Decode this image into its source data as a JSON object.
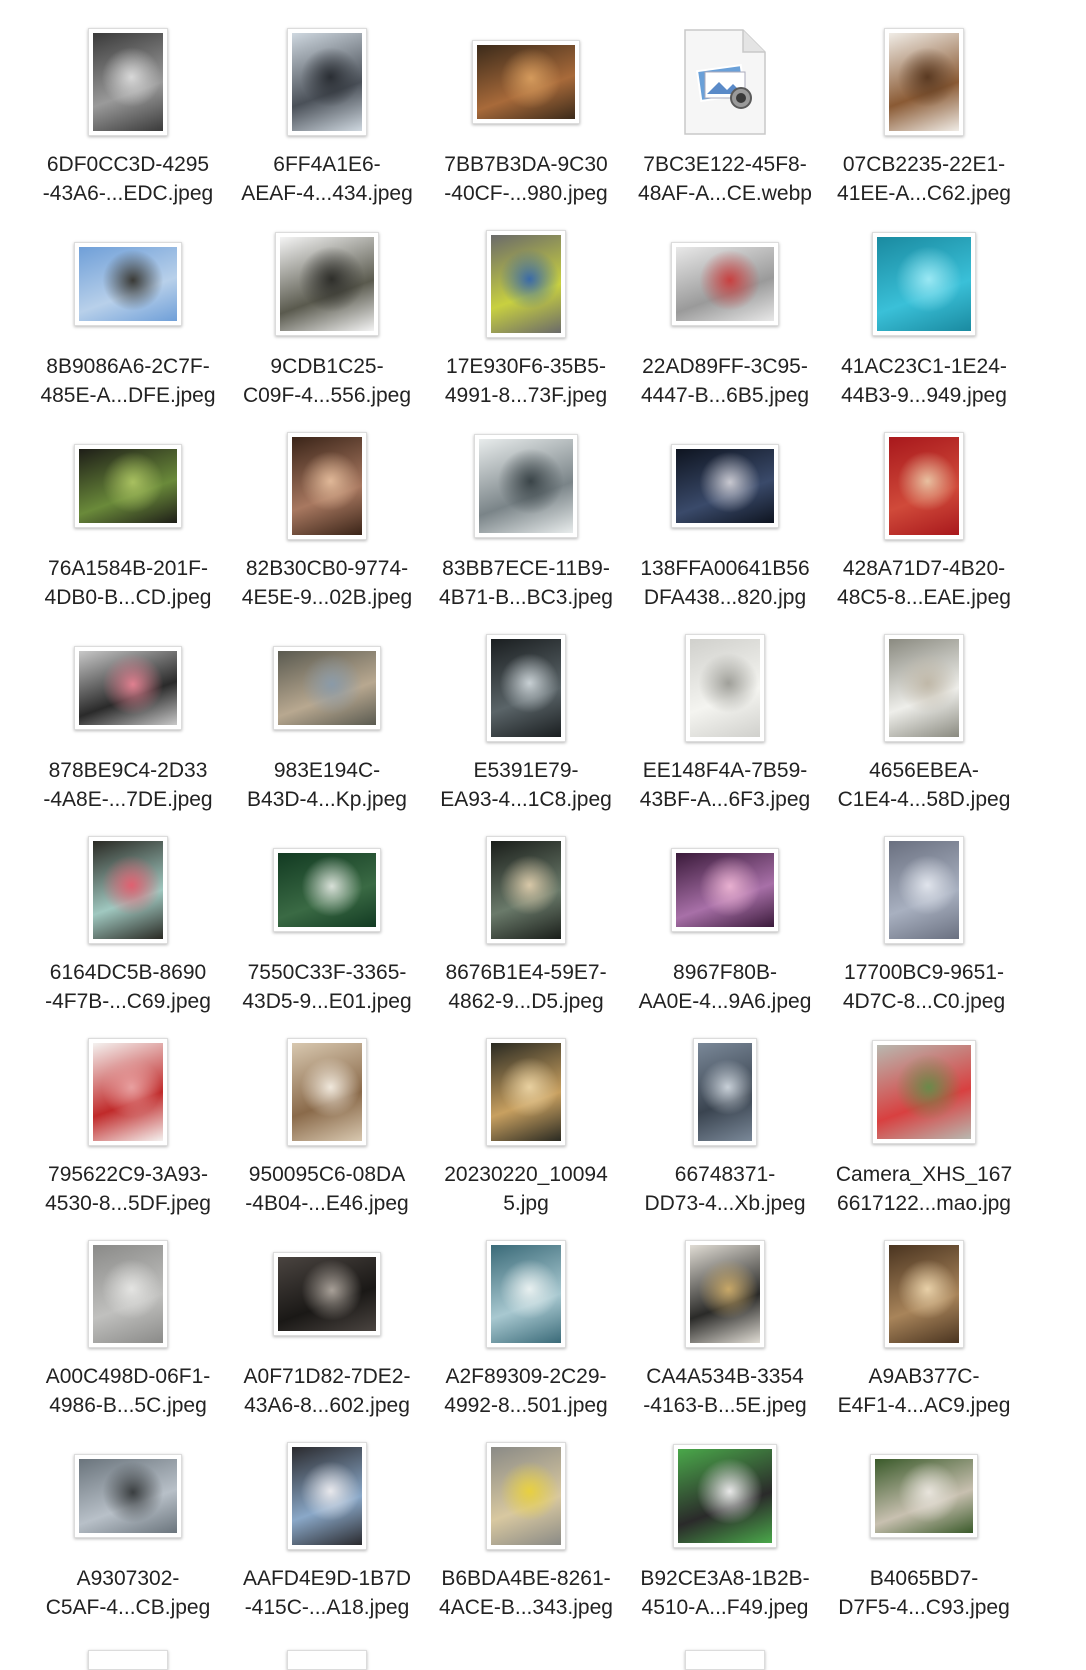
{
  "files": [
    {
      "line1": "6DF0CC3D-4295",
      "line2": "-43A6-...EDC.jpeg",
      "shape": "portrait",
      "colors": [
        "#3a3a3a",
        "#9a9a9a",
        "#d8d8d8"
      ]
    },
    {
      "line1": "6FF4A1E6-",
      "line2": "AEAF-4...434.jpeg",
      "shape": "portrait",
      "colors": [
        "#cfd8e0",
        "#4a5058",
        "#2a2e34"
      ]
    },
    {
      "line1": "7BB7B3DA-9C30",
      "line2": "-40CF-...980.jpeg",
      "shape": "landscape",
      "colors": [
        "#3b2a1a",
        "#a86a3a",
        "#d49a5c"
      ]
    },
    {
      "line1": "7BC3E122-45F8-",
      "line2": "48AF-A...CE.webp",
      "shape": "doc",
      "colors": [
        "#f2f2f2",
        "#6aa0d8",
        "#888888"
      ]
    },
    {
      "line1": "07CB2235-22E1-",
      "line2": "41EE-A...C62.jpeg",
      "shape": "portrait",
      "colors": [
        "#f0ece6",
        "#8a5a34",
        "#5a3a22"
      ]
    },
    {
      "line1": "8B9086A6-2C7F-",
      "line2": "485E-A...DFE.jpeg",
      "shape": "landscape",
      "colors": [
        "#6f9fd8",
        "#b8d0ea",
        "#3a3a36"
      ]
    },
    {
      "line1": "9CDB1C25-",
      "line2": "C09F-4...556.jpeg",
      "shape": "square",
      "colors": [
        "#f4f4f4",
        "#5a5a4e",
        "#2e2e2a"
      ]
    },
    {
      "line1": "17E930F6-35B5-",
      "line2": "4991-8...73F.jpeg",
      "shape": "portrait",
      "colors": [
        "#6a6a6a",
        "#c8d040",
        "#3a6aa8"
      ]
    },
    {
      "line1": "22AD89FF-3C95-",
      "line2": "4447-B...6B5.jpeg",
      "shape": "landscape",
      "colors": [
        "#e8e8e8",
        "#9a9a9a",
        "#c84040"
      ]
    },
    {
      "line1": "41AC23C1-1E24-",
      "line2": "44B3-9...949.jpeg",
      "shape": "square",
      "colors": [
        "#1a8aa0",
        "#3ac0d8",
        "#9ae8f4"
      ]
    },
    {
      "line1": "76A1584B-201F-",
      "line2": "4DB0-B...CD.jpeg",
      "shape": "landscape",
      "colors": [
        "#1e1e18",
        "#6a8a3a",
        "#a8c060"
      ]
    },
    {
      "line1": "82B30CB0-9774-",
      "line2": "4E5E-9...02B.jpeg",
      "shape": "portrait",
      "colors": [
        "#3a2418",
        "#a87860",
        "#e0b898"
      ]
    },
    {
      "line1": "83BB7ECE-11B9-",
      "line2": "4B71-B...BC3.jpeg",
      "shape": "square",
      "colors": [
        "#e8ecec",
        "#7a8488",
        "#3a4448"
      ]
    },
    {
      "line1": "138FFA00641B56",
      "line2": "DFA438...820.jpg",
      "shape": "landscape",
      "colors": [
        "#0e1420",
        "#3a4a6a",
        "#c8c8d0"
      ]
    },
    {
      "line1": "428A71D7-4B20-",
      "line2": "48C5-8...EAE.jpeg",
      "shape": "portrait",
      "colors": [
        "#a8181c",
        "#d04a3a",
        "#e8c0a0"
      ]
    },
    {
      "line1": "878BE9C4-2D33",
      "line2": "-4A8E-...7DE.jpeg",
      "shape": "landscape",
      "colors": [
        "#c8c8c8",
        "#2a2a2a",
        "#e08090"
      ]
    },
    {
      "line1": "983E194C-",
      "line2": "B43D-4...Kp.jpeg",
      "shape": "landscape",
      "colors": [
        "#5a5a50",
        "#b8a890",
        "#8a9aa8"
      ]
    },
    {
      "line1": "E5391E79-",
      "line2": "EA93-4...1C8.jpeg",
      "shape": "portrait",
      "colors": [
        "#1a1e20",
        "#5a6468",
        "#c8d0d4"
      ]
    },
    {
      "line1": "EE148F4A-7B59-",
      "line2": "43BF-A...6F3.jpeg",
      "shape": "portrait",
      "colors": [
        "#d0d0cc",
        "#f4f4f0",
        "#a0a09a"
      ]
    },
    {
      "line1": "4656EBEA-",
      "line2": "C1E4-4...58D.jpeg",
      "shape": "portrait",
      "colors": [
        "#8a8a80",
        "#eeeeea",
        "#c0b8a8"
      ]
    },
    {
      "line1": "6164DC5B-8690",
      "line2": "-4F7B-...C69.jpeg",
      "shape": "portrait",
      "colors": [
        "#2a2a24",
        "#a0c8c0",
        "#e06070"
      ]
    },
    {
      "line1": "7550C33F-3365-",
      "line2": "43D5-9...E01.jpeg",
      "shape": "landscape",
      "colors": [
        "#123a22",
        "#3a6a44",
        "#d8e0d8"
      ]
    },
    {
      "line1": "8676B1E4-59E7-",
      "line2": "4862-9...D5.jpeg",
      "shape": "portrait",
      "colors": [
        "#1a1e1a",
        "#6a7a6a",
        "#d8c8a8"
      ]
    },
    {
      "line1": "8967F80B-",
      "line2": "AA0E-4...9A6.jpeg",
      "shape": "landscape",
      "colors": [
        "#3a1a3a",
        "#a870a8",
        "#e8b0d0"
      ]
    },
    {
      "line1": "17700BC9-9651-",
      "line2": "4D7C-8...C0.jpeg",
      "shape": "portrait",
      "colors": [
        "#6a7080",
        "#a8b0c0",
        "#e0e4ec"
      ]
    },
    {
      "line1": "795622C9-3A93-",
      "line2": "4530-8...5DF.jpeg",
      "shape": "portrait",
      "colors": [
        "#f4f2f0",
        "#c02a2a",
        "#e8a0a0"
      ]
    },
    {
      "line1": "950095C6-08DA",
      "line2": "-4B04-...E46.jpeg",
      "shape": "portrait",
      "colors": [
        "#d8c8b0",
        "#8a6a4a",
        "#f0e8dc"
      ]
    },
    {
      "line1": "20230220_10094",
      "line2": "5.jpg",
      "shape": "portrait",
      "colors": [
        "#2a2a22",
        "#c8a060",
        "#e8d0a0"
      ]
    },
    {
      "line1": "66748371-",
      "line2": "DD73-4...Xb.jpeg",
      "shape": "tall",
      "colors": [
        "#7a8898",
        "#3a4450",
        "#c8d0d8"
      ]
    },
    {
      "line1": "Camera_XHS_167",
      "line2": "6617122...mao.jpg",
      "shape": "square",
      "colors": [
        "#b8b8b0",
        "#d84040",
        "#6a8a4a"
      ]
    },
    {
      "line1": "A00C498D-06F1-",
      "line2": "4986-B...5C.jpeg",
      "shape": "portrait",
      "colors": [
        "#8a8a88",
        "#c0c0be",
        "#e4e4e2"
      ]
    },
    {
      "line1": "A0F71D82-7DE2-",
      "line2": "43A6-8...602.jpeg",
      "shape": "landscape",
      "colors": [
        "#4a4440",
        "#1a1816",
        "#a8a098"
      ]
    },
    {
      "line1": "A2F89309-2C29-",
      "line2": "4992-8...501.jpeg",
      "shape": "portrait",
      "colors": [
        "#3a6a78",
        "#a8c8d0",
        "#e8f0f0"
      ]
    },
    {
      "line1": "CA4A534B-3354",
      "line2": "-4163-B...5E.jpeg",
      "shape": "portrait",
      "colors": [
        "#e0dcd4",
        "#2a2a28",
        "#c8a868"
      ]
    },
    {
      "line1": "A9AB377C-",
      "line2": "E4F1-4...AC9.jpeg",
      "shape": "portrait",
      "colors": [
        "#4a3420",
        "#a8845a",
        "#e8d0a8"
      ]
    },
    {
      "line1": "A9307302-",
      "line2": "C5AF-4...CB.jpeg",
      "shape": "landscape",
      "colors": [
        "#6a747c",
        "#b8c0c8",
        "#3a3e40"
      ]
    },
    {
      "line1": "AAFD4E9D-1B7D",
      "line2": "-415C-...A18.jpeg",
      "shape": "portrait",
      "colors": [
        "#2a2a2e",
        "#8aa8c8",
        "#e8e8ec"
      ]
    },
    {
      "line1": "B6BDA4BE-8261-",
      "line2": "4ACE-B...343.jpeg",
      "shape": "portrait",
      "colors": [
        "#8a8a86",
        "#d8c8a0",
        "#e8d040"
      ]
    },
    {
      "line1": "B92CE3A8-1B2B-",
      "line2": "4510-A...F49.jpeg",
      "shape": "square",
      "colors": [
        "#4aa84a",
        "#2a2a2a",
        "#e8e8e8"
      ]
    },
    {
      "line1": "B4065BD7-",
      "line2": "D7F5-4...C93.jpeg",
      "shape": "landscape",
      "colors": [
        "#3a5a2a",
        "#c8c0b0",
        "#e8e4dc"
      ]
    }
  ]
}
